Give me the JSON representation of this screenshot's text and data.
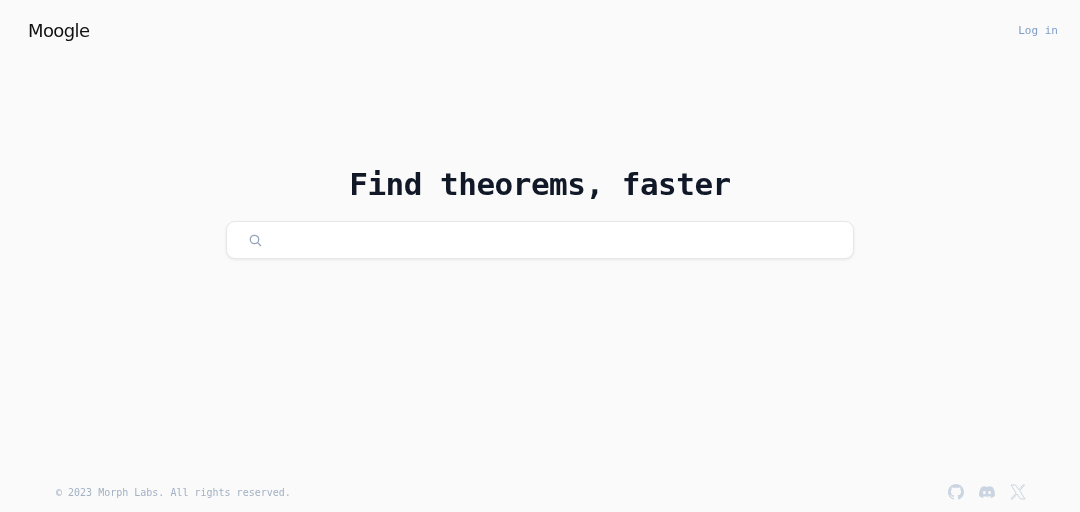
{
  "header": {
    "logo": "Moogle",
    "login": "Log in"
  },
  "hero": {
    "title": "Find theorems, faster"
  },
  "footer": {
    "copyright": "© 2023 Morph Labs. All rights reserved."
  }
}
